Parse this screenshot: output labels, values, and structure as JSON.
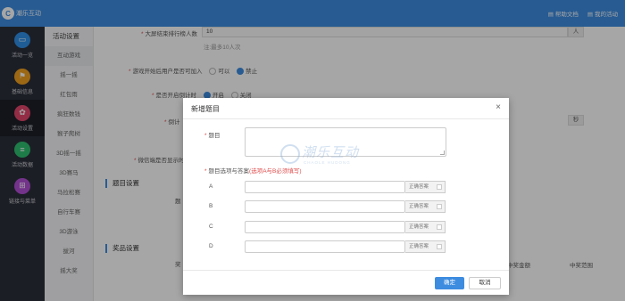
{
  "brand": {
    "name": "潮乐互动",
    "mark": "C"
  },
  "topnav": {
    "help": "帮助文档",
    "my_activity": "我的活动"
  },
  "sidebar": {
    "items": [
      {
        "label": "活动一览",
        "icon": "monitor-icon",
        "color": "#2f8fe6",
        "glyph": "▭"
      },
      {
        "label": "基础信息",
        "icon": "flag-icon",
        "color": "#f0a020",
        "glyph": "⚑"
      },
      {
        "label": "活动设置",
        "icon": "gear-icon",
        "color": "#e0456a",
        "glyph": "✿"
      },
      {
        "label": "活动数据",
        "icon": "database-icon",
        "color": "#2fbf71",
        "glyph": "≡"
      },
      {
        "label": "链接与菜单",
        "icon": "grid-icon",
        "color": "#b24fd6",
        "glyph": "⊞"
      }
    ],
    "active_index": 2
  },
  "subnav": {
    "title": "活动设置",
    "items": [
      {
        "label": "互动游戏",
        "group": true
      },
      {
        "label": "摇一摇"
      },
      {
        "label": "红包雨"
      },
      {
        "label": "疯狂数钱"
      },
      {
        "label": "猴子爬树"
      },
      {
        "label": "3D摇一摇"
      },
      {
        "label": "3D赛马"
      },
      {
        "label": "马拉松赛"
      },
      {
        "label": "自行车赛"
      },
      {
        "label": "3D游泳"
      },
      {
        "label": "拔河"
      },
      {
        "label": "摇大奖"
      }
    ]
  },
  "form": {
    "winners_label": "大屏结束排行榜人数",
    "winners_value": "10",
    "winners_unit": "人",
    "winners_hint": "注:最多10人次",
    "allow_join_label": "游戏开始后用户是否可加入",
    "allow_join_opt1": "可以",
    "allow_join_opt2": "禁止",
    "countdown_label": "是否开启倒计时",
    "countdown_opt1": "开启",
    "countdown_opt2": "关闭",
    "countdown_time_label": "倒计",
    "countdown_unit": "秒",
    "wechat_label": "微信端是否显示时",
    "section_question": "题目设置",
    "question_partial": "题",
    "section_prize": "奖品设置",
    "prize_partial": "奖",
    "col_amount": "中奖金额",
    "col_range": "中奖范围"
  },
  "modal": {
    "title": "新增题目",
    "question_label": "题目",
    "options_hint_prefix": "题目选项与答案",
    "options_hint_red": "(选项A与B必须填写)",
    "options": [
      {
        "letter": "A",
        "correct_label": "正确答案"
      },
      {
        "letter": "B",
        "correct_label": "正确答案"
      },
      {
        "letter": "C",
        "correct_label": "正确答案"
      },
      {
        "letter": "D",
        "correct_label": "正确答案"
      }
    ],
    "confirm": "确定",
    "cancel": "取消"
  },
  "watermark": {
    "text": "潮乐互动",
    "sub": "CHAOLE HUDONG"
  },
  "colors": {
    "accent": "#3d8ce0",
    "sidebar_bg": "#2b2f3a",
    "required": "#e04c4c"
  }
}
